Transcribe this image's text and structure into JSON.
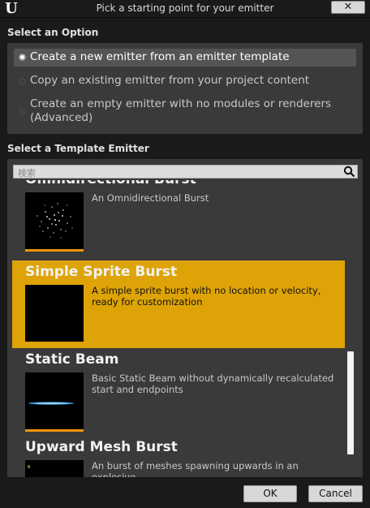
{
  "window": {
    "title": "Pick a starting point for your emitter",
    "close_label": "✕",
    "logo_glyph": "U"
  },
  "options": {
    "heading": "Select an Option",
    "items": [
      {
        "label": "Create a new emitter from an emitter template",
        "selected": true
      },
      {
        "label": "Copy an existing emitter from your project content",
        "selected": false
      },
      {
        "label": "Create an empty emitter with no modules or renderers (Advanced)",
        "selected": false
      }
    ]
  },
  "templates": {
    "heading": "Select a Template Emitter",
    "search_placeholder": "検索",
    "items": [
      {
        "title": "Omnidirectional Burst",
        "description": "An Omnidirectional Burst",
        "selected": false,
        "thumb": "particle-burst"
      },
      {
        "title": "Simple Sprite Burst",
        "description": "A simple sprite burst with no location or velocity, ready for customization",
        "selected": true,
        "thumb": "empty"
      },
      {
        "title": "Static Beam",
        "description": "Basic Static Beam without dynamically recalculated start and endpoints",
        "selected": false,
        "thumb": "beam"
      },
      {
        "title": "Upward Mesh Burst",
        "description": "An burst of meshes spawning upwards in an explosive",
        "selected": false,
        "thumb": "mesh"
      }
    ]
  },
  "buttons": {
    "ok": "OK",
    "cancel": "Cancel"
  },
  "colors": {
    "selection": "#dea407",
    "thumb_bar": "#f0950b",
    "beam": "#3aa8e6"
  }
}
